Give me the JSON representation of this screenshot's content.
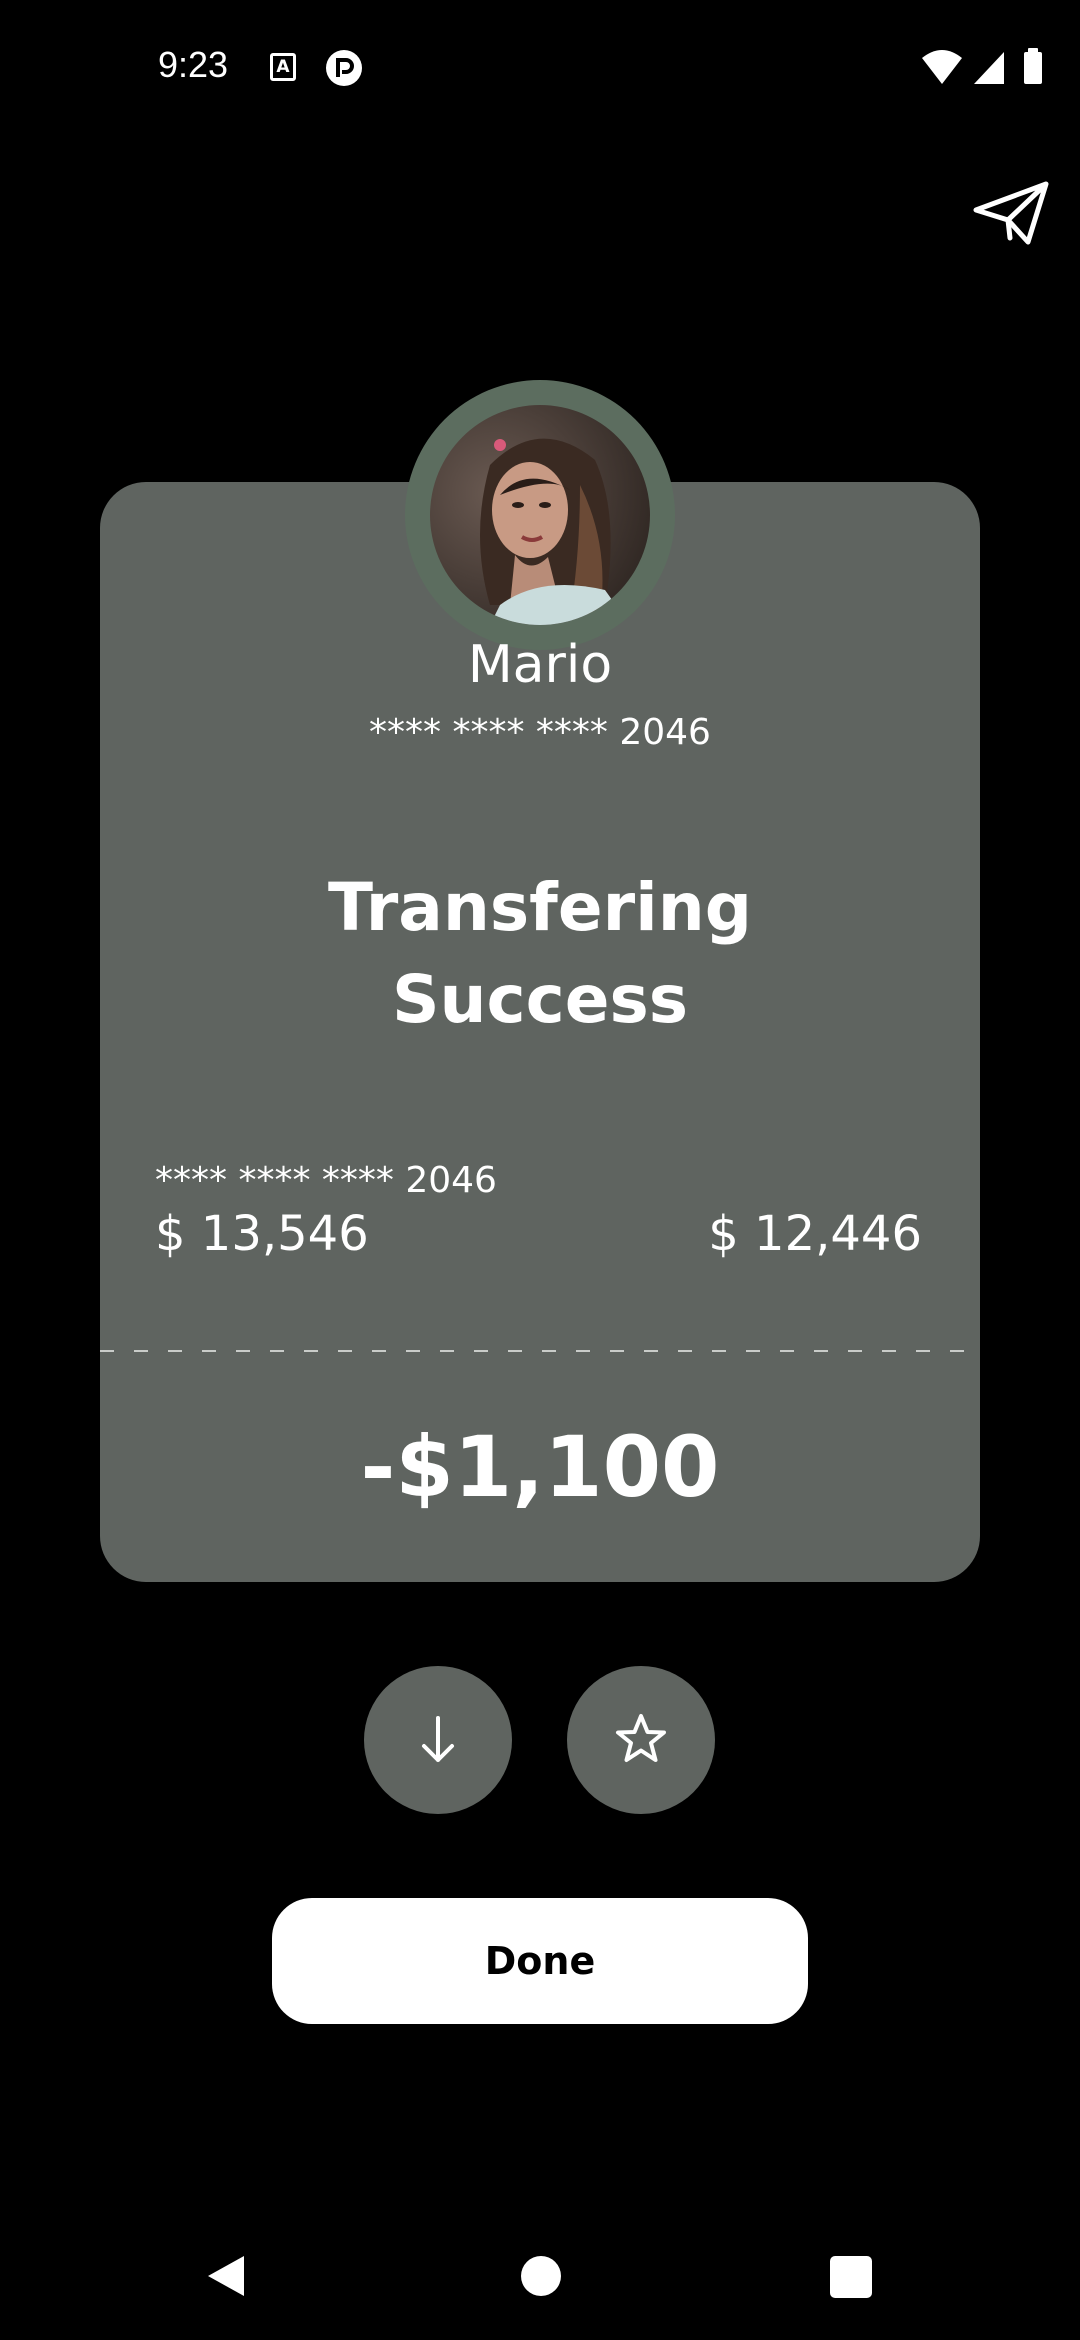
{
  "status_bar": {
    "time": "9:23",
    "icons": [
      "keyboard-a-icon",
      "r-app-icon",
      "wifi-icon",
      "signal-icon",
      "battery-icon"
    ],
    "keyboard_glyph": "A"
  },
  "header": {
    "send_icon": "paper-plane-icon"
  },
  "recipient": {
    "name": "Mario",
    "card_number": "**** **** **** 2046"
  },
  "transfer": {
    "title_line1": "Transfering",
    "title_line2": "Success",
    "sender_card": "**** **** **** 2046",
    "balance_before": "$ 13,546",
    "balance_after": "$ 12,446",
    "amount": "-$1,100"
  },
  "actions": {
    "download_icon": "arrow-down-icon",
    "favorite_icon": "star-icon",
    "done_label": "Done"
  },
  "nav_bar": {
    "icons": [
      "back-icon",
      "home-icon",
      "recents-icon"
    ]
  },
  "colors": {
    "background": "#000000",
    "card": "#5f6460",
    "avatar_ring": "#5c6d5f",
    "button": "#ffffff",
    "text": "#ffffff"
  }
}
